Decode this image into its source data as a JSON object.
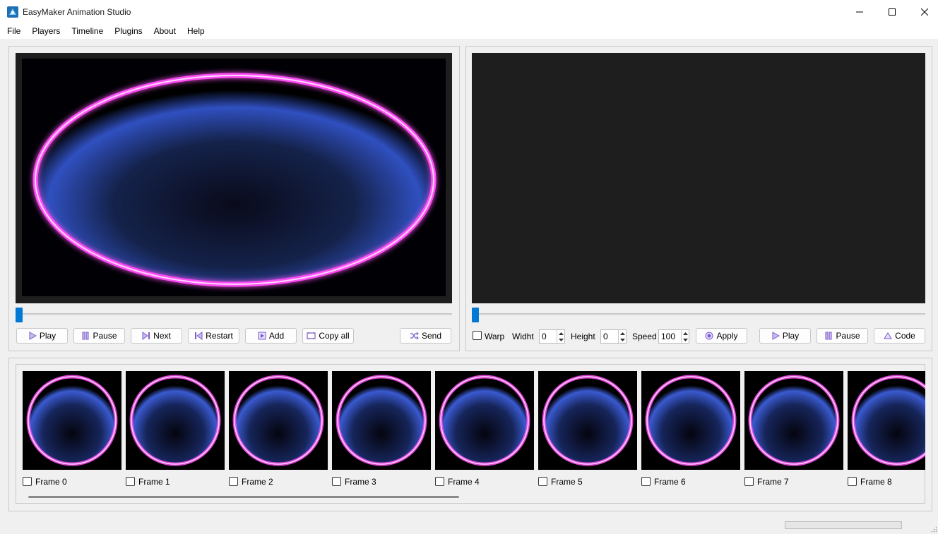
{
  "window": {
    "title": "EasyMaker Animation Studio"
  },
  "menu": [
    "File",
    "Players",
    "Timeline",
    "Plugins",
    "About",
    "Help"
  ],
  "left_player": {
    "buttons": {
      "play": "Play",
      "pause": "Pause",
      "next": "Next",
      "restart": "Restart",
      "add": "Add",
      "copy_all": "Copy all",
      "send": "Send"
    },
    "position": 0
  },
  "right_player": {
    "warp_label": "Warp",
    "width_label": "Widht",
    "width_value": "0",
    "height_label": "Height",
    "height_value": "0",
    "speed_label": "Speed",
    "speed_value": "100",
    "buttons": {
      "apply": "Apply",
      "play": "Play",
      "pause": "Pause",
      "code": "Code"
    },
    "position": 0
  },
  "timeline": {
    "frames": [
      "Frame 0",
      "Frame 1",
      "Frame 2",
      "Frame 3",
      "Frame 4",
      "Frame 5",
      "Frame 6",
      "Frame 7",
      "Frame 8"
    ]
  },
  "colors": {
    "accent": "#0078d4",
    "viewer_bg": "#1e1e1e",
    "ring": "#ff3df5",
    "glow_blue": "#3a6cff"
  }
}
